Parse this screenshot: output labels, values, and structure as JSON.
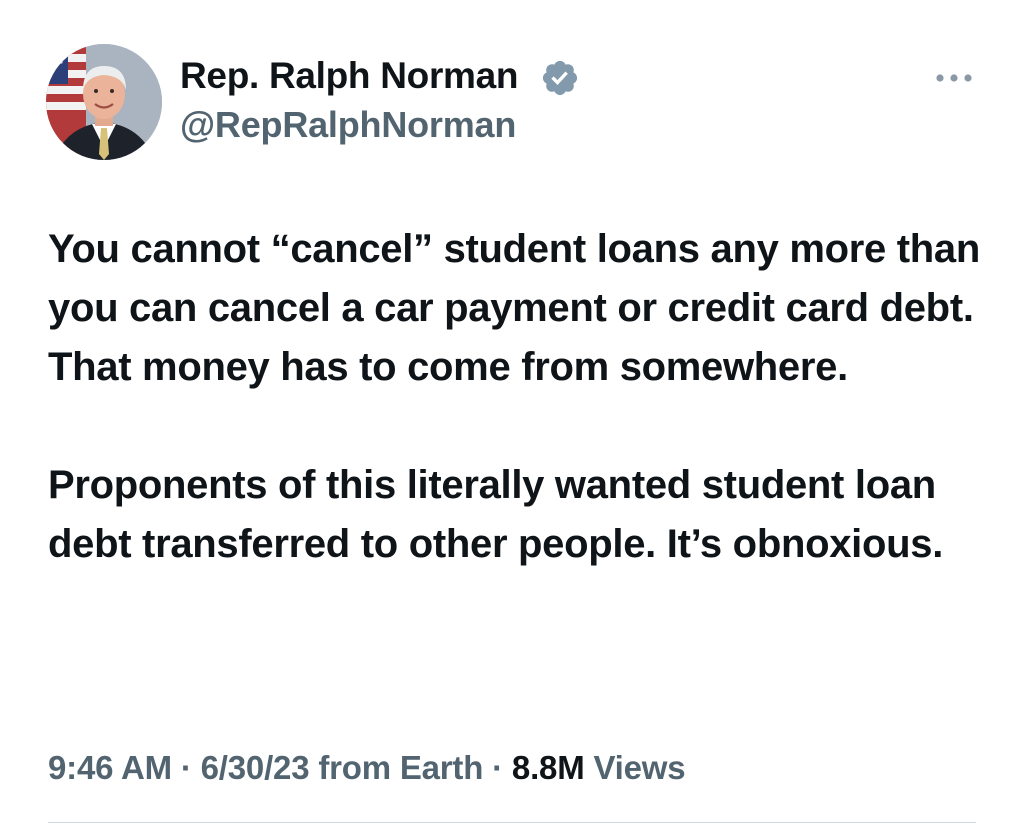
{
  "author": {
    "display_name": "Rep. Ralph Norman",
    "handle": "@RepRalphNorman",
    "verified_icon": "verified-badge-icon",
    "avatar": "profile-photo"
  },
  "tweet": {
    "paragraphs": [
      "You cannot “cancel” student loans any more than you can cancel a car payment or credit card debt. That money has to come from somewhere.",
      "Proponents of this literally wanted student loan debt transferred to other people. It’s obnoxious."
    ]
  },
  "meta": {
    "time": "9:46 AM",
    "separator": " · ",
    "date": "6/30/23",
    "source": "from Earth",
    "views_count": "8.8M",
    "views_label": "Views"
  },
  "colors": {
    "text": "#0f1419",
    "secondary": "#536471",
    "verified": "#829aab",
    "divider": "#cfd9de"
  },
  "icons": {
    "more": "more-options-icon"
  }
}
